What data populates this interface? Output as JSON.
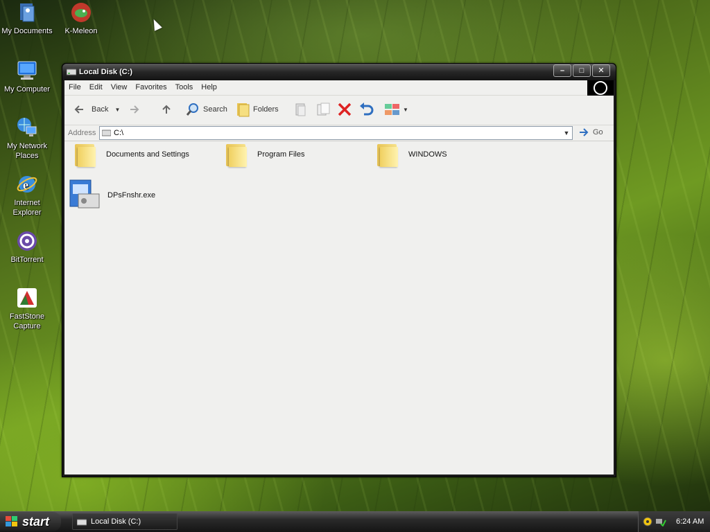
{
  "desktop": {
    "icons": [
      {
        "label": "My Documents",
        "icon": "my-documents-icon"
      },
      {
        "label": "K-Meleon",
        "icon": "k-meleon-icon"
      },
      {
        "label": "My Computer",
        "icon": "my-computer-icon"
      },
      {
        "label": "My Network Places",
        "icon": "network-places-icon"
      },
      {
        "label": "Internet Explorer",
        "icon": "internet-explorer-icon"
      },
      {
        "label": "BitTorrent",
        "icon": "bittorrent-icon"
      },
      {
        "label": "FastStone Capture",
        "icon": "faststone-icon"
      }
    ]
  },
  "window": {
    "title": "Local Disk (C:)",
    "controls": {
      "minimize": "–",
      "maximize": "□",
      "close": "✕"
    },
    "menu": [
      "File",
      "Edit",
      "View",
      "Favorites",
      "Tools",
      "Help"
    ],
    "toolbar": {
      "back": "Back",
      "search": "Search",
      "folders": "Folders"
    },
    "address": {
      "label": "Address",
      "value": "C:\\",
      "go": "Go"
    },
    "items": [
      {
        "name": "Documents and Settings",
        "type": "folder"
      },
      {
        "name": "Program Files",
        "type": "folder"
      },
      {
        "name": "WINDOWS",
        "type": "folder"
      },
      {
        "name": "DPsFnshr.exe",
        "type": "exe"
      }
    ]
  },
  "taskbar": {
    "start": "start",
    "task": "Local Disk (C:)",
    "clock": "6:24 AM"
  },
  "colors": {
    "accent": "#2f6fc0",
    "taskbar": "#1a1a1a",
    "window_bg": "#f0f0ee"
  }
}
